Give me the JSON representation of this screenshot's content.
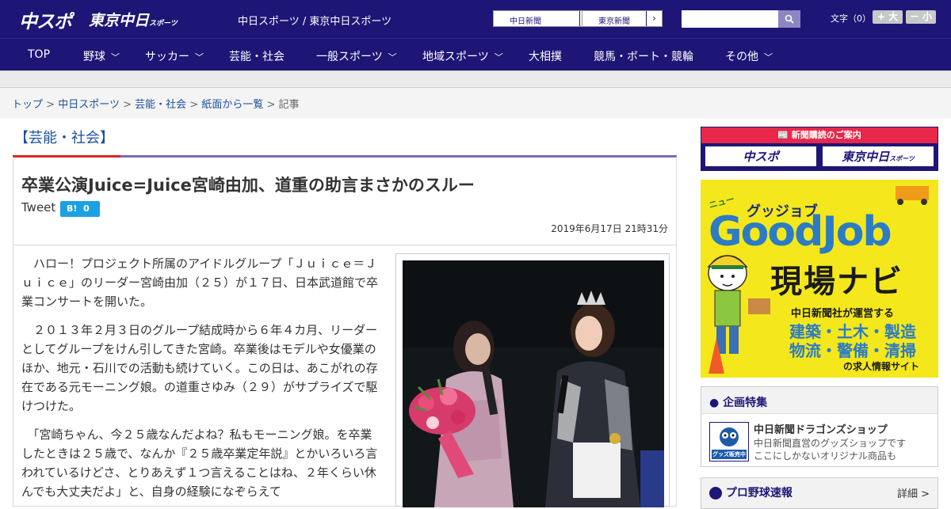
{
  "header": {
    "logo_chuspo": "中スポ",
    "logo_tokyo": "東京中日",
    "logo_tokyo_small": "スポーツ",
    "site_name": "中日スポーツ / 東京中日スポーツ",
    "ext_link1": "中日新聞",
    "ext_link2": "東京新聞",
    "font_size_label": "文字（0）",
    "font_bigger": "+ 大",
    "font_smaller": "－ 小",
    "search_placeholder": ""
  },
  "nav": {
    "items": [
      "TOP",
      "野球",
      "サッカー",
      "芸能・社会",
      "一般スポーツ",
      "地域スポーツ",
      "大相撲",
      "競馬・ボート・競輪",
      "その他"
    ]
  },
  "breadcrumb": {
    "items": [
      "トップ",
      "中日スポーツ",
      "芸能・社会",
      "紙面から一覧"
    ],
    "current": "記事",
    "separator": ">"
  },
  "article": {
    "category": "【芸能・社会】",
    "title": "卒業公演Juice=Juice宮崎由加、道重の助言まさかのスルー",
    "tweet_label": "Tweet",
    "hatena_label": "B!",
    "hatena_count": "0",
    "date": "2019年6月17日 21時31分",
    "paragraphs": [
      "ハロー！プロジェクト所属のアイドルグループ「Ｊｕｉｃｅ＝Ｊｕｉｃｅ」のリーダー宮崎由加（２５）が１７日、日本武道館で卒業コンサートを開いた。",
      "２０１３年２月３日のグループ結成時から６年４カ月、リーダーとしてグループをけん引してきた宮崎。卒業後はモデルや女優業のほか、地元・石川での活動も続けていく。この日は、あこがれの存在である元モーニング娘。の道重さゆみ（２９）がサプライズで駆けつけた。",
      "「宮崎ちゃん、今２５歳なんだよね？私もモーニング娘。を卒業したときは２５歳で、なんか『２５歳卒業定年説』とかいろいろ言われているけどさ、とりあえず１つ言えることはね、２年くらい休んでも大丈夫だよ」と、自身の経験になぞらえて"
    ]
  },
  "sidebar": {
    "subscribe_title": "新聞購読のご案内",
    "subscribe_chuspo": "中スポ",
    "subscribe_tokyo": "東京中日",
    "subscribe_tokyo_small": "スポーツ",
    "ad": {
      "top": "グッジョブ",
      "brand": "GoodJob",
      "sub": "現場ナビ",
      "operator": "中日新聞社が運営する",
      "line1": "建築・土木・製造",
      "line2": "物流・警備・清掃",
      "line3": "の求人情報サイト",
      "tag": "ニュー"
    },
    "feature_title": "企画特集",
    "feature_item_title": "中日新聞ドラゴンズショップ",
    "feature_item_desc1": "中日新聞直営のグッズショップです",
    "feature_item_desc2": "ここにしかないオリジナル商品も",
    "feature_thumb_label": "グッズ販売中",
    "baseball_title": "プロ野球速報",
    "baseball_more": "詳細 >"
  },
  "colors": {
    "brand": "#1e1676",
    "accent_red": "#d8262a",
    "link": "#1d4fa0",
    "ad_yellow": "#f4e71c"
  }
}
